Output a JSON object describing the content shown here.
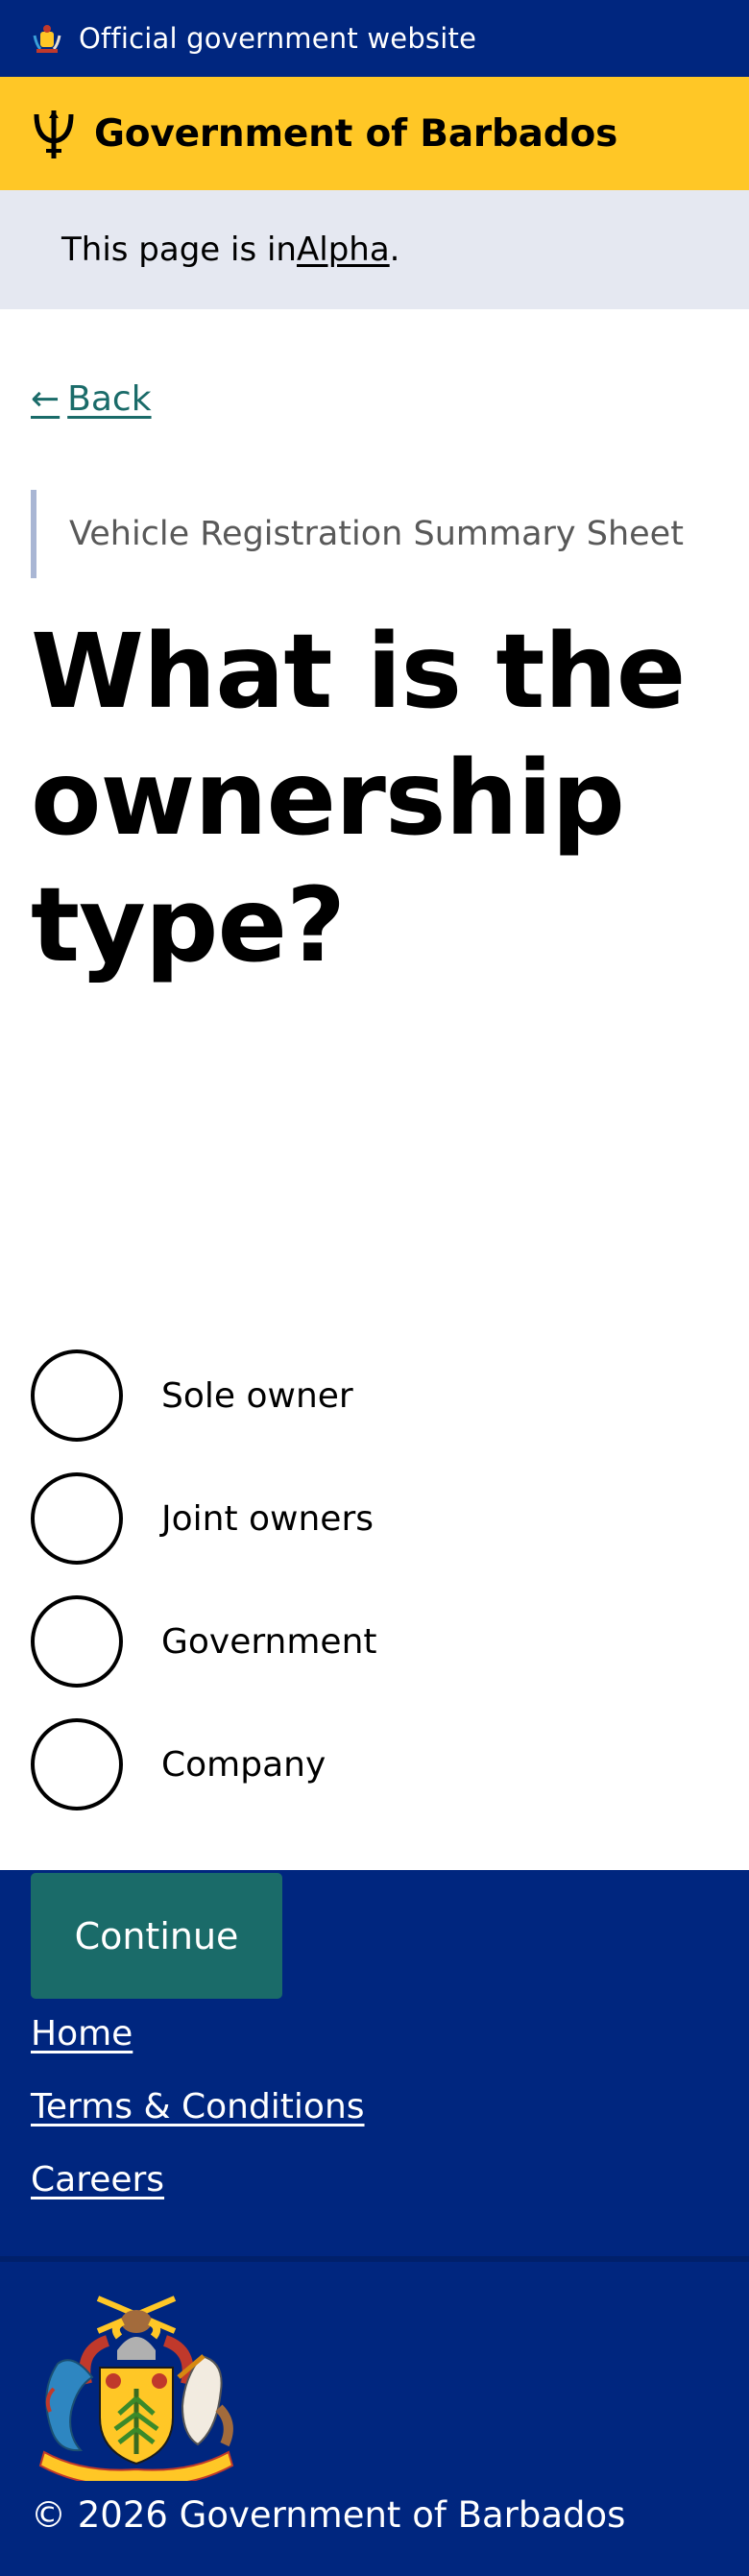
{
  "header": {
    "official_text": "Official government website",
    "gov_name": "Government of Barbados"
  },
  "phase_banner": {
    "prefix": "This page is in ",
    "link": "Alpha",
    "suffix": "."
  },
  "main": {
    "back_label": "Back",
    "caption": "Vehicle Registration Summary Sheet",
    "heading": "What is the ownership type?",
    "options": [
      "Sole owner",
      "Joint owners",
      "Government",
      "Company"
    ],
    "continue_label": "Continue"
  },
  "footer": {
    "links": [
      "Home",
      "Terms & Conditions",
      "Careers"
    ],
    "copyright": "© 2026 Government of Barbados"
  },
  "colors": {
    "navy": "#00267f",
    "gold": "#ffc726",
    "teal": "#1a6b69",
    "banner_bg": "#e5e8f1"
  }
}
